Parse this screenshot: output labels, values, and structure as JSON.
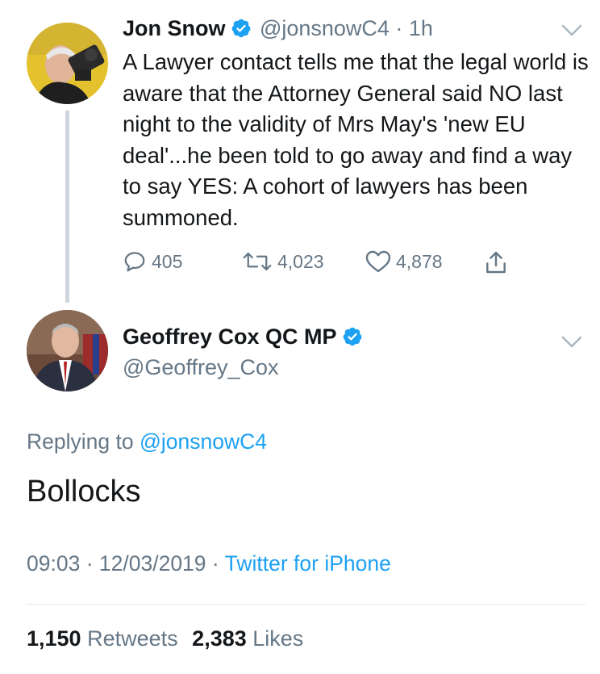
{
  "colors": {
    "accent": "#1da1f2",
    "text": "#14171a",
    "secondary": "#657786",
    "like": "#e0245e"
  },
  "parent_tweet": {
    "author_name": "Jon Snow",
    "handle": "@jonsnowC4",
    "separator": "·",
    "time": "1h",
    "text": "A Lawyer contact tells me that the legal world is aware that the Attorney General said NO last night to the validity of Mrs May's 'new EU deal'...he been told to go away and find a way to say YES: A cohort of lawyers has been summoned.",
    "replies": "405",
    "retweets": "4,023",
    "likes": "4,878",
    "icons": [
      "reply-icon",
      "retweet-icon",
      "like-icon",
      "share-icon",
      "verified-icon",
      "chevron-down-icon"
    ]
  },
  "reply_tweet": {
    "author_name": "Geoffrey Cox QC MP",
    "handle": "@Geoffrey_Cox",
    "replying_prefix": "Replying to",
    "replying_to": "@jonsnowC4",
    "text": "Bollocks",
    "time": "09:03",
    "date": "12/03/2019",
    "dot1": "·",
    "dot2": "·",
    "source": "Twitter for iPhone",
    "retweet_count": "1,150",
    "retweet_label": "Retweets",
    "like_count": "2,383",
    "like_label": "Likes"
  }
}
